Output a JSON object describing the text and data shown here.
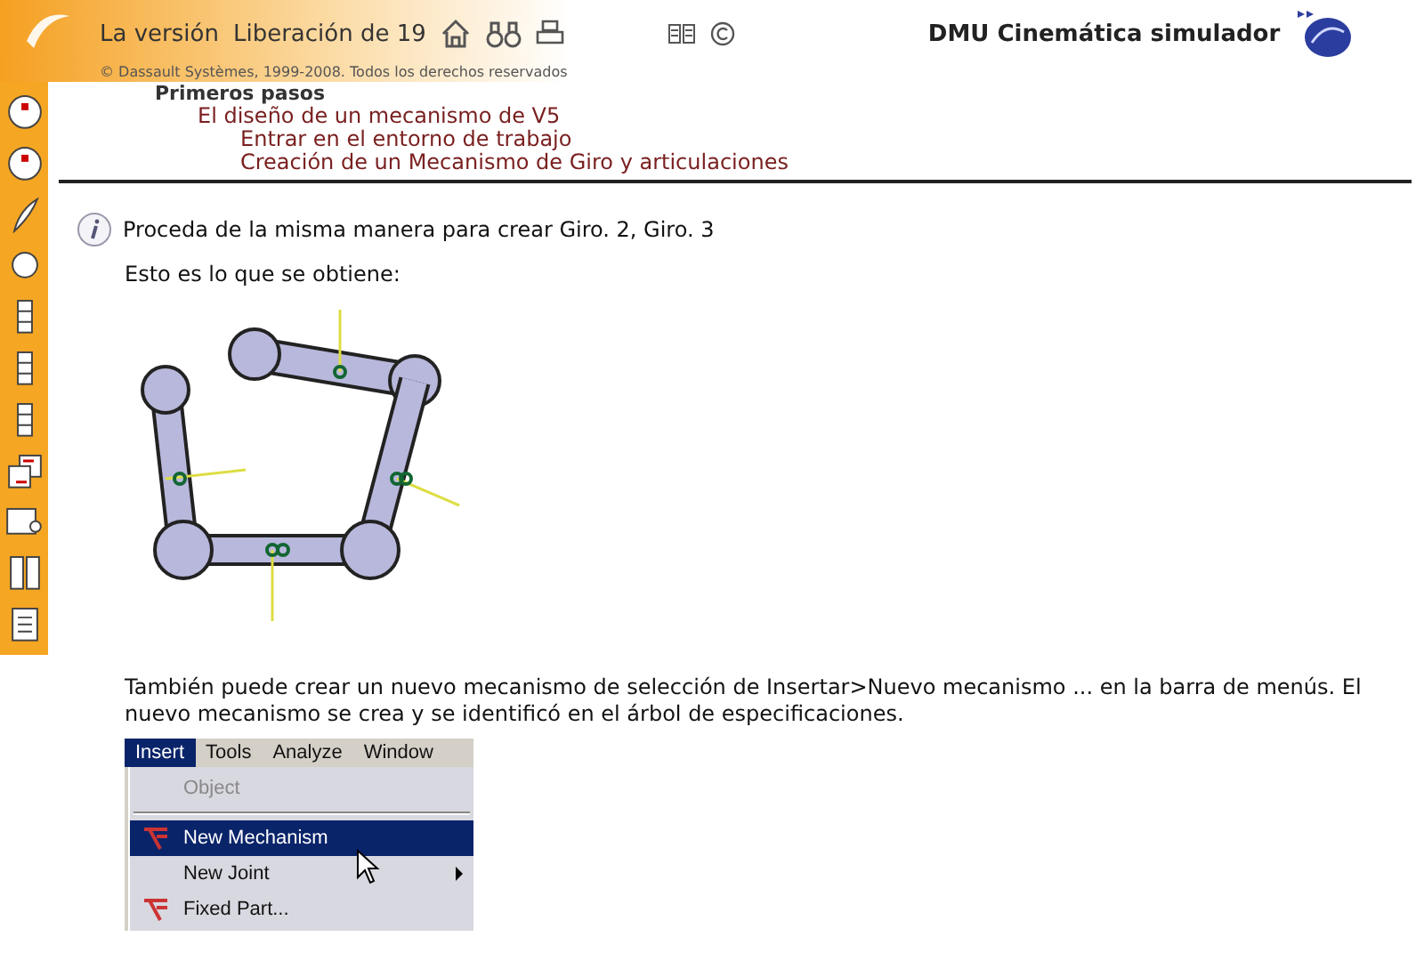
{
  "header": {
    "title": "La versión",
    "release": "Liberación de 19",
    "copyright": "© Dassault Systèmes, 1999-2008. Todos los derechos reservados",
    "product": "DMU Cinemática simulador"
  },
  "breadcrumb": {
    "label": "Primeros pasos",
    "children": [
      {
        "label": "El diseño de un mecanismo de V5",
        "children": [
          {
            "label": "Entrar en el entorno de trabajo"
          },
          {
            "label": "Creación de un Mecanismo de Giro y articulaciones"
          }
        ]
      }
    ]
  },
  "note": "Proceda de la misma manera para crear Giro. 2, Giro. 3",
  "result_intro": "Esto es lo que se obtiene:",
  "paragraph": "También puede crear un nuevo mecanismo de selección de Insertar>Nuevo mecanismo ... en la barra de menús. El nuevo mecanismo se crea y se identificó en el árbol de especificaciones.",
  "menu_bar": [
    {
      "label": "Insert",
      "selected": true
    },
    {
      "label": "Tools",
      "selected": false
    },
    {
      "label": "Analyze",
      "selected": false
    },
    {
      "label": "Window",
      "selected": false
    }
  ],
  "menu_items": [
    {
      "label": "Object",
      "kind": "plain",
      "disabled": true,
      "selected": false,
      "submenu": false
    },
    {
      "label": "New Mechanism",
      "kind": "icon",
      "disabled": false,
      "selected": true,
      "submenu": false
    },
    {
      "label": "New Joint",
      "kind": "plain",
      "disabled": false,
      "selected": false,
      "submenu": true
    },
    {
      "label": "Fixed Part...",
      "kind": "icon",
      "disabled": false,
      "selected": false,
      "submenu": false
    }
  ]
}
